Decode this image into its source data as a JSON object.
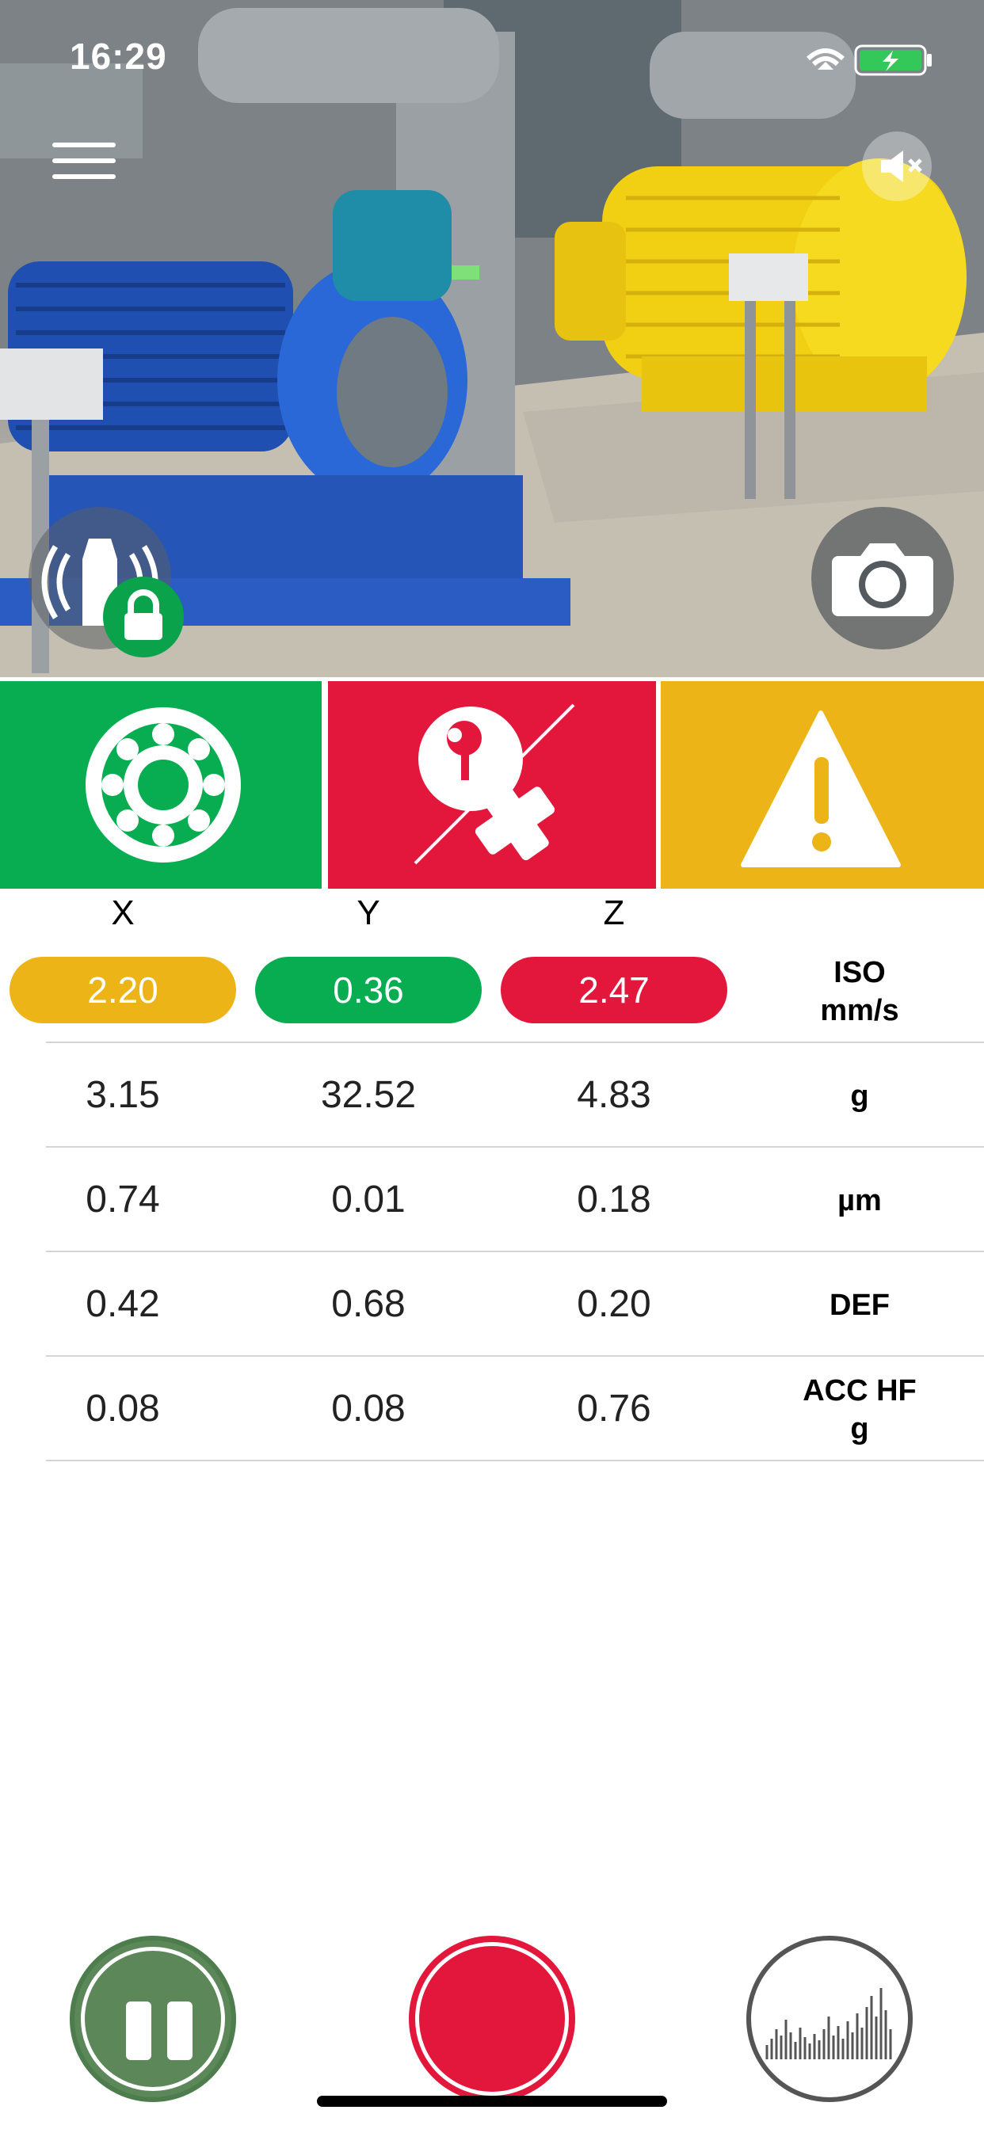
{
  "status_bar": {
    "time": "16:29"
  },
  "axes": {
    "x": "X",
    "y": "Y",
    "z": "Z"
  },
  "iso_row": {
    "x": "2.20",
    "y": "0.36",
    "z": "2.47",
    "unit_line1": "ISO",
    "unit_line2": "mm/s",
    "colors": {
      "x": "#edb418",
      "y": "#08ad52",
      "z": "#e3173c"
    }
  },
  "rows": [
    {
      "x": "3.15",
      "y": "32.52",
      "z": "4.83",
      "unit_line1": "g",
      "unit_line2": ""
    },
    {
      "x": "0.74",
      "y": "0.01",
      "z": "0.18",
      "unit_line1": "µm",
      "unit_line2": ""
    },
    {
      "x": "0.42",
      "y": "0.68",
      "z": "0.20",
      "unit_line1": "DEF",
      "unit_line2": ""
    },
    {
      "x": "0.08",
      "y": "0.08",
      "z": "0.76",
      "unit_line1": "ACC HF",
      "unit_line2": "g"
    }
  ],
  "tiles": [
    {
      "icon": "bearing-icon",
      "color": "#08ad52"
    },
    {
      "icon": "misalignment-icon",
      "color": "#e3173c"
    },
    {
      "icon": "warning-icon",
      "color": "#edb418"
    }
  ],
  "controls": {
    "pause_icon": "pause-icon",
    "record_icon": "record-icon",
    "spectrum_icon": "spectrum-icon"
  }
}
